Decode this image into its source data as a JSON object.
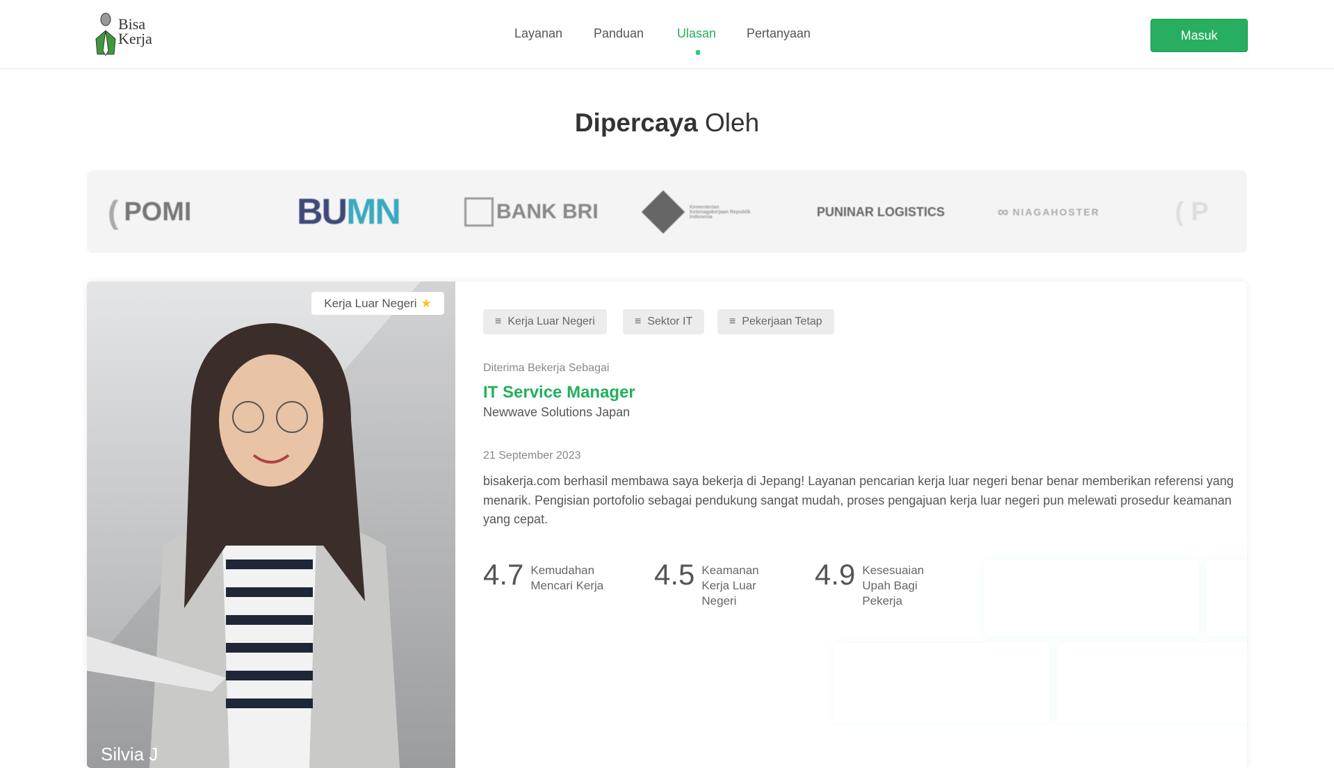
{
  "nav": {
    "brand": "Bisa Kerja",
    "brand_line1": "Bisa",
    "brand_line2": "Kerja",
    "items": [
      {
        "label": "Layanan"
      },
      {
        "label": "Panduan"
      },
      {
        "label": "Ulasan",
        "active": true
      },
      {
        "label": "Pertanyaan"
      }
    ],
    "login_label": "Masuk"
  },
  "colors": {
    "accent": "#27ae60",
    "active": "#22b05a"
  },
  "trusted": {
    "title_bold": "Dipercaya",
    "title_rest": " Oleh",
    "logos": [
      "POMI",
      "BUMN",
      "BANK BRI",
      "Kementerian Ketenagakerjaan Republik Indonesia",
      "PUNINAR LOGISTICS",
      "NIAGAHOSTER",
      "POMI"
    ]
  },
  "review": {
    "badge": "Kerja Luar Negeri",
    "badge_icon": "star-icon",
    "name": "Silvia J",
    "tags": [
      "Kerja Luar Negeri",
      "Sektor IT",
      "Pekerjaan Tetap"
    ],
    "accepted_label": "Diterima Bekerja Sebagai",
    "job_title": "IT Service Manager",
    "company": "Newwave Solutions Japan",
    "date": "21 September 2023",
    "text": "bisakerja.com berhasil membawa saya bekerja di Jepang! Layanan pencarian kerja luar negeri benar benar memberikan referensi yang menarik. Pengisian portofolio sebagai pendukung sangat mudah, proses pengajuan kerja luar negeri pun melewati prosedur keamanan yang cepat.",
    "ratings": [
      {
        "score": "4.7",
        "label": "Kemudahan Mencari Kerja"
      },
      {
        "score": "4.5",
        "label": "Keamanan Kerja Luar Negeri"
      },
      {
        "score": "4.9",
        "label": "Kesesuaian Upah Bagi Pekerja"
      }
    ]
  }
}
